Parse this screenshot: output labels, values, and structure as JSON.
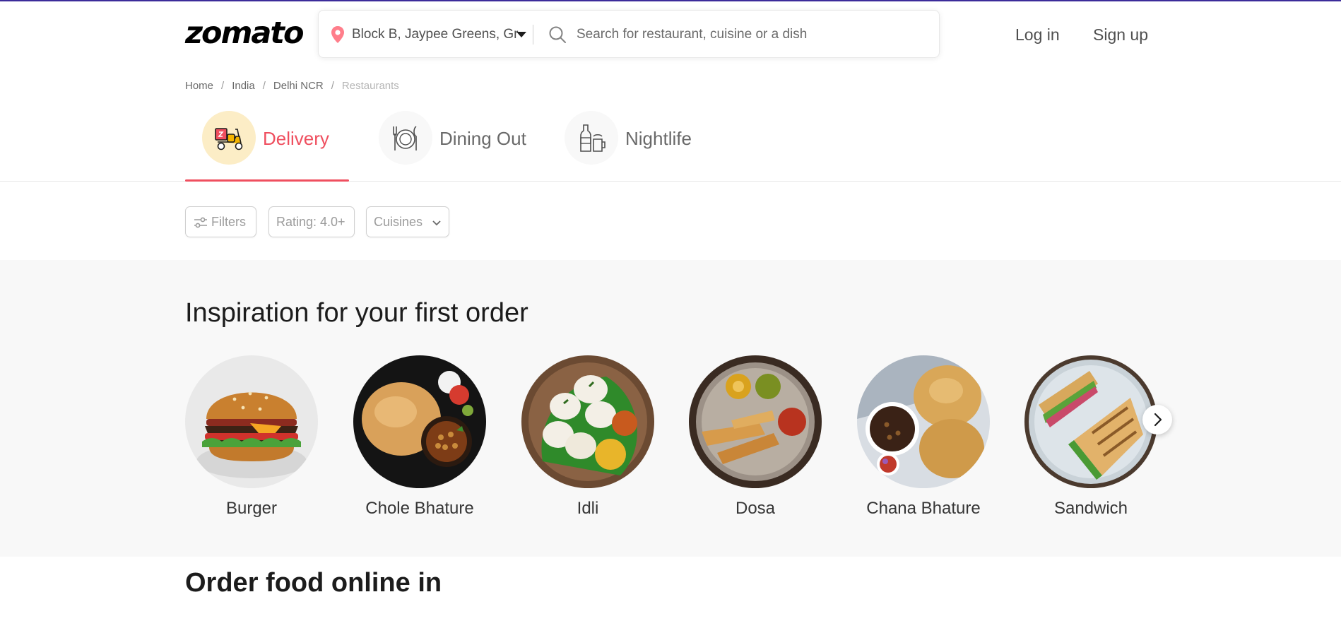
{
  "header": {
    "logo_text": "zomato",
    "location": {
      "value": "Block B, Jaypee Greens, Greater Noida",
      "icon": "location-pin-icon",
      "caret_icon": "caret-down-icon"
    },
    "search": {
      "icon": "search-icon",
      "placeholder": "Search for restaurant, cuisine or a dish",
      "value": ""
    },
    "login_label": "Log in",
    "signup_label": "Sign up",
    "accent_color": "#ef4f5f"
  },
  "breadcrumb": {
    "items": [
      "Home",
      "India",
      "Delhi NCR",
      "Restaurants"
    ],
    "separator": "/"
  },
  "tabs": [
    {
      "label": "Delivery",
      "icon": "scooter-icon",
      "active": true
    },
    {
      "label": "Dining Out",
      "icon": "plate-cutlery-icon",
      "active": false
    },
    {
      "label": "Nightlife",
      "icon": "bottle-glass-icon",
      "active": false
    }
  ],
  "filters": [
    {
      "label": "Filters",
      "icon": "sliders-icon"
    },
    {
      "label": "Rating: 4.0+"
    },
    {
      "label": "Cuisines",
      "icon": "chevron-down-icon"
    }
  ],
  "inspiration": {
    "title": "Inspiration for your first order",
    "dishes": [
      {
        "name": "Burger"
      },
      {
        "name": "Chole Bhature"
      },
      {
        "name": "Idli"
      },
      {
        "name": "Dosa"
      },
      {
        "name": "Chana Bhature"
      },
      {
        "name": "Sandwich"
      }
    ],
    "next_icon": "chevron-right-icon"
  },
  "order_section": {
    "title": "Order food online in"
  }
}
